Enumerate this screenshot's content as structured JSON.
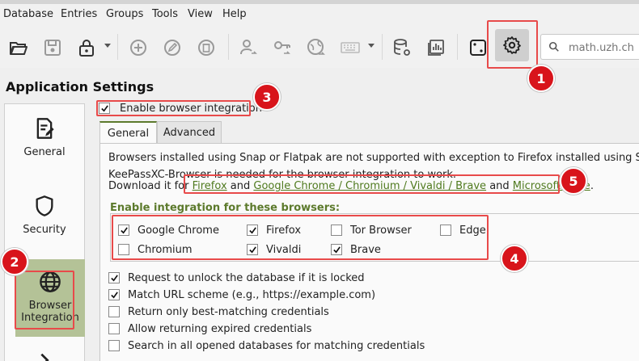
{
  "menubar": {
    "items": [
      "Database",
      "Entries",
      "Groups",
      "Tools",
      "View",
      "Help"
    ]
  },
  "toolbar": {
    "buttons": [
      {
        "icon": "folder-open-icon"
      },
      {
        "icon": "save-icon"
      },
      {
        "icon": "lock-icon"
      },
      {
        "icon": "add-entry-icon"
      },
      {
        "icon": "edit-entry-icon"
      },
      {
        "icon": "delete-entry-icon"
      },
      {
        "icon": "copy-username-icon"
      },
      {
        "icon": "copy-password-icon"
      },
      {
        "icon": "copy-url-icon"
      },
      {
        "icon": "autotype-keyboard-icon"
      },
      {
        "icon": "database-settings-icon"
      },
      {
        "icon": "reports-icon"
      },
      {
        "icon": "password-generator-icon"
      },
      {
        "icon": "settings-gear-icon"
      }
    ],
    "search_placeholder": "math.uzh.ch"
  },
  "page": {
    "title": "Application Settings"
  },
  "sidebar": {
    "items": [
      {
        "label": "General",
        "icon": "general-settings-icon"
      },
      {
        "label": "Security",
        "icon": "shield-icon"
      },
      {
        "label": "Browser\nIntegration",
        "icon": "globe-icon"
      }
    ]
  },
  "browser_integration": {
    "enable_label": "Enable browser integration",
    "enable_checked": true,
    "tabs": [
      "General",
      "Advanced"
    ],
    "active_tab": "General",
    "snap_note": "Browsers installed using Snap or Flatpak are not supported with exception to Firefox installed using Snap.",
    "needed_note": "KeePassXC-Browser is needed for the browser integration to work.",
    "download_prefix": "Download it for ",
    "link_firefox": "Firefox",
    "and1": " and ",
    "link_chrome": "Google Chrome / Chromium / Vivaldi / Brave",
    "and2": " and ",
    "link_edge": "Microsoft Edge",
    "period": ".",
    "section_header": "Enable integration for these browsers:",
    "browsers": [
      {
        "label": "Google Chrome",
        "checked": true
      },
      {
        "label": "Firefox",
        "checked": true
      },
      {
        "label": "Tor Browser",
        "checked": false
      },
      {
        "label": "Edge",
        "checked": false
      },
      {
        "label": "Chromium",
        "checked": false
      },
      {
        "label": "Vivaldi",
        "checked": true
      },
      {
        "label": "Brave",
        "checked": true
      }
    ],
    "options": [
      {
        "label": "Request to unlock the database if it is locked",
        "checked": true
      },
      {
        "label": "Match URL scheme (e.g., https://example.com)",
        "checked": true
      },
      {
        "label": "Return only best-matching credentials",
        "checked": false
      },
      {
        "label": "Allow returning expired credentials",
        "checked": false
      },
      {
        "label": "Search in all opened databases for matching credentials",
        "checked": false
      }
    ]
  },
  "annotations": {
    "badges": [
      "1",
      "2",
      "3",
      "4",
      "5"
    ],
    "color": "#d8141b"
  }
}
